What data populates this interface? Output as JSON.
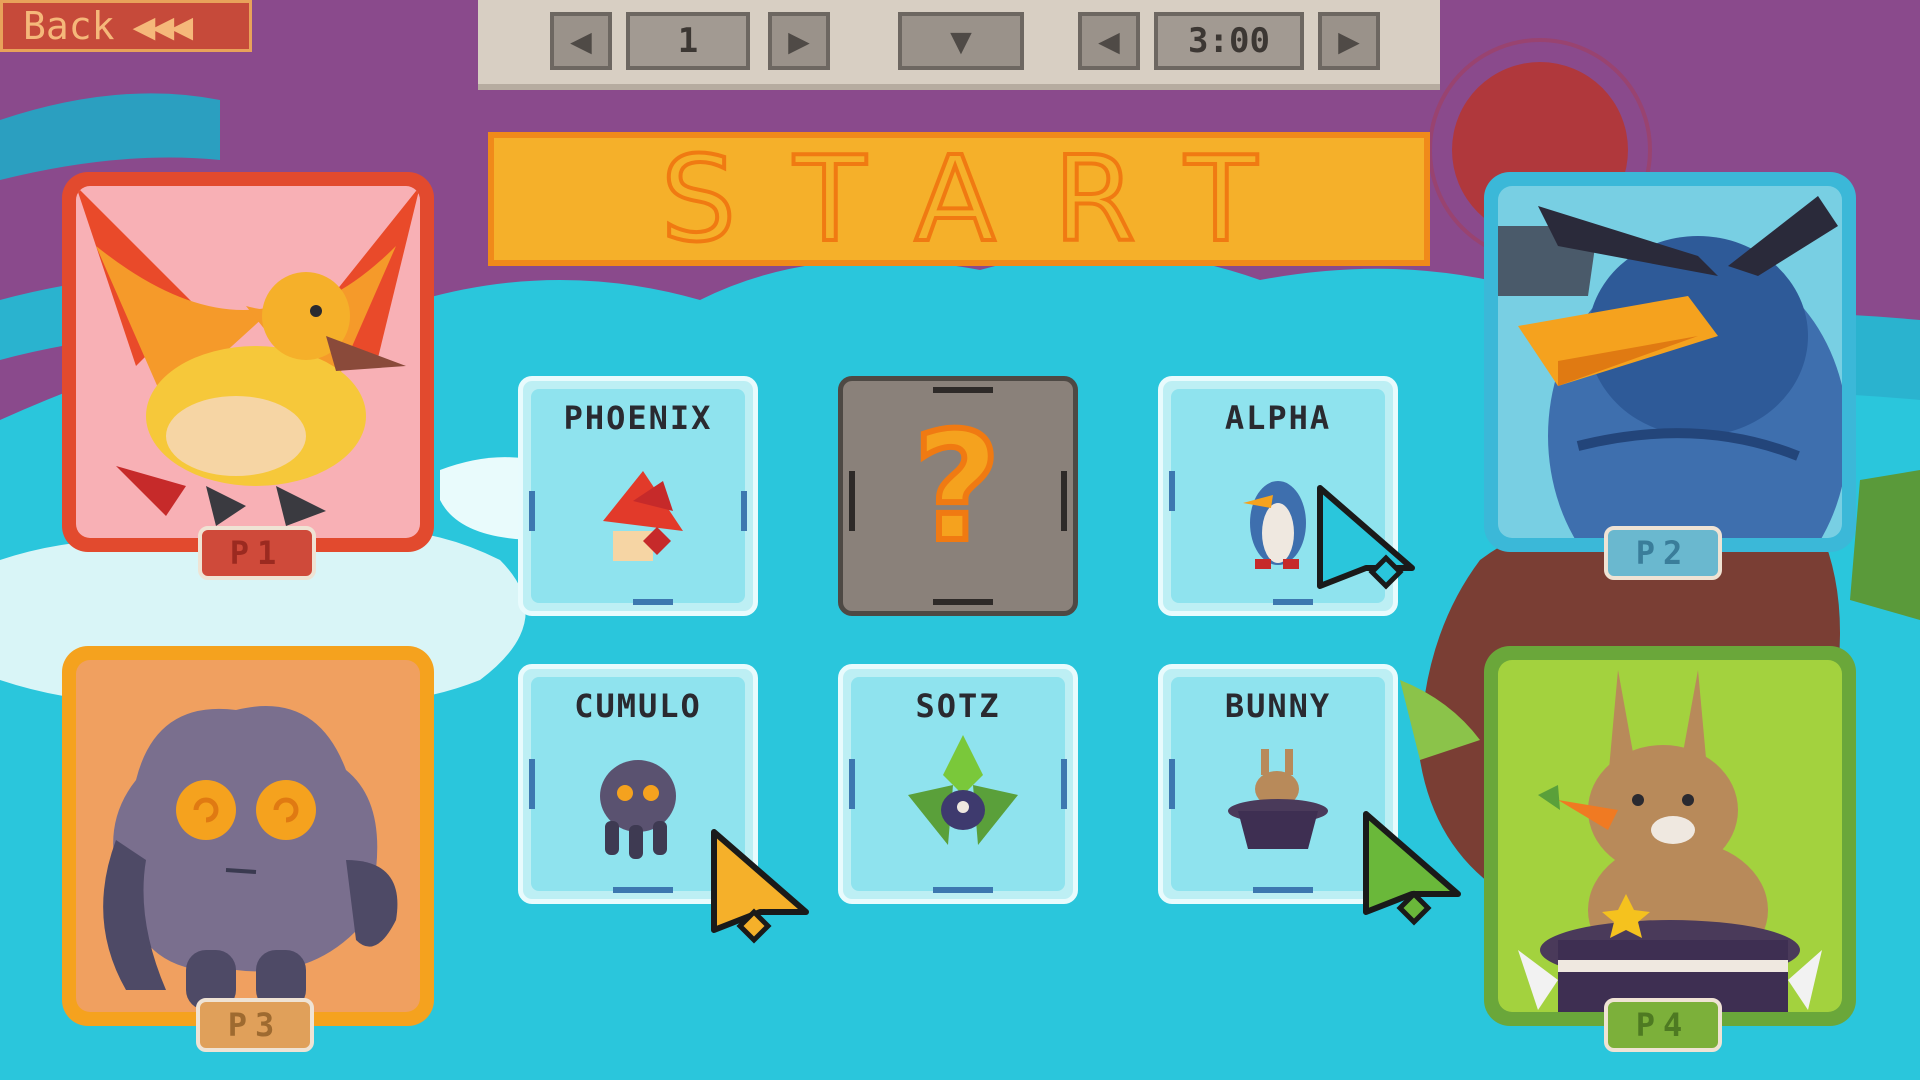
{
  "back": {
    "label": "Back",
    "arrows": "◀◀◀"
  },
  "topbar": {
    "rounds_value": "1",
    "timer_value": "3:00",
    "left_arrow": "◀",
    "right_arrow": "▶",
    "down_arrow": "▼"
  },
  "start": {
    "label": "START"
  },
  "players": [
    {
      "tag": "P1",
      "character": "phoenix",
      "color": "#e24a2e"
    },
    {
      "tag": "P2",
      "character": "alpha",
      "color": "#3bb8d8"
    },
    {
      "tag": "P3",
      "character": "cumulo",
      "color": "#f5a21e"
    },
    {
      "tag": "P4",
      "character": "bunny",
      "color": "#6aa73a"
    }
  ],
  "roster": [
    {
      "name": "PHOENIX"
    },
    {
      "name": "?",
      "random": true
    },
    {
      "name": "ALPHA"
    },
    {
      "name": "CUMULO"
    },
    {
      "name": "SOTZ"
    },
    {
      "name": "BUNNY"
    }
  ],
  "colors": {
    "sky": "#8a4a8c",
    "sea": "#2ac6dc",
    "accent_start": "#f5b02a"
  }
}
